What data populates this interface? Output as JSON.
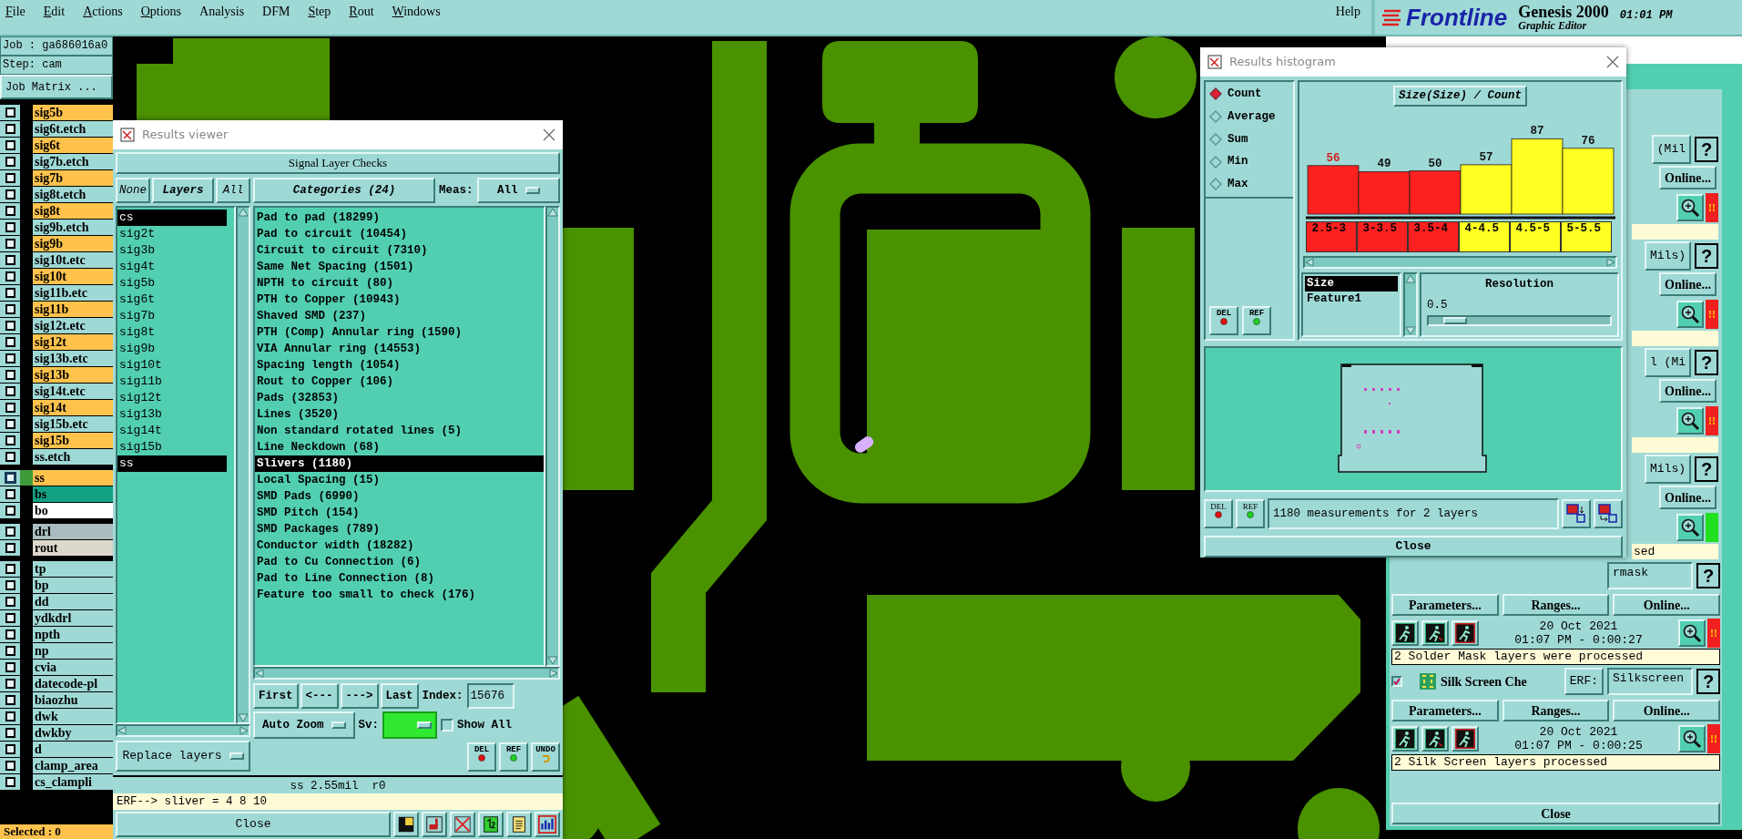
{
  "menu_bar": {
    "items": [
      {
        "label": "File",
        "underlined": true
      },
      {
        "label": "Edit",
        "underlined": true
      },
      {
        "label": "Actions",
        "underlined": true
      },
      {
        "label": "Options",
        "underlined": true
      },
      {
        "label": "Analysis",
        "underlined": false
      },
      {
        "label": "DFM",
        "underlined": false
      },
      {
        "label": "Step",
        "underlined": true
      },
      {
        "label": "Rout",
        "underlined": true
      },
      {
        "label": "Windows",
        "underlined": true
      }
    ],
    "help": "Help",
    "logo": "Frontline",
    "product": "Genesis 2000",
    "subtitle": "Graphic Editor",
    "time": "01:01 PM"
  },
  "job_panel": {
    "job": "Job : ga686016a0",
    "step": "Step: cam",
    "job_matrix_button": "Job Matrix ...",
    "layer_groups": [
      {
        "layers": [
          {
            "name": "sig5b",
            "color": "#ffc34d",
            "selected": false
          },
          {
            "name": "sig6t.etch",
            "color": "#9fd9d6",
            "selected": false
          },
          {
            "name": "sig6t",
            "color": "#ffc34d",
            "selected": false
          },
          {
            "name": "sig7b.etch",
            "color": "#9fd9d6",
            "selected": false
          },
          {
            "name": "sig7b",
            "color": "#ffc34d",
            "selected": false
          },
          {
            "name": "sig8t.etch",
            "color": "#9fd9d6",
            "selected": false
          },
          {
            "name": "sig8t",
            "color": "#ffc34d",
            "selected": false
          },
          {
            "name": "sig9b.etch",
            "color": "#9fd9d6",
            "selected": false
          },
          {
            "name": "sig9b",
            "color": "#ffc34d",
            "selected": false
          },
          {
            "name": "sig10t.etc",
            "color": "#9fd9d6",
            "selected": false
          },
          {
            "name": "sig10t",
            "color": "#ffc34d",
            "selected": false
          },
          {
            "name": "sig11b.etc",
            "color": "#9fd9d6",
            "selected": false
          },
          {
            "name": "sig11b",
            "color": "#ffc34d",
            "selected": false
          },
          {
            "name": "sig12t.etc",
            "color": "#9fd9d6",
            "selected": false
          },
          {
            "name": "sig12t",
            "color": "#ffc34d",
            "selected": false
          },
          {
            "name": "sig13b.etc",
            "color": "#9fd9d6",
            "selected": false
          },
          {
            "name": "sig13b",
            "color": "#ffc34d",
            "selected": false
          },
          {
            "name": "sig14t.etc",
            "color": "#9fd9d6",
            "selected": false
          },
          {
            "name": "sig14t",
            "color": "#ffc34d",
            "selected": false
          },
          {
            "name": "sig15b.etc",
            "color": "#9fd9d6",
            "selected": false
          },
          {
            "name": "sig15b",
            "color": "#ffc34d",
            "selected": false
          },
          {
            "name": "ss.etch",
            "color": "#9fd9d6",
            "selected": false
          }
        ]
      },
      {
        "layers": [
          {
            "name": "ss",
            "color": "#ffc34d",
            "selected": true
          },
          {
            "name": "bs",
            "color": "#12a184",
            "selected": false
          },
          {
            "name": "bo",
            "color": "#ffffff",
            "selected": false
          }
        ]
      },
      {
        "layers": [
          {
            "name": "drl",
            "color": "#a9bdc0",
            "selected": false
          },
          {
            "name": "rout",
            "color": "#ddd8cc",
            "selected": false
          }
        ]
      },
      {
        "layers": [
          {
            "name": "tp",
            "color": "#9fd9d6",
            "selected": false
          },
          {
            "name": "bp",
            "color": "#9fd9d6",
            "selected": false
          },
          {
            "name": "dd",
            "color": "#9fd9d6",
            "selected": false
          },
          {
            "name": "ydkdrl",
            "color": "#9fd9d6",
            "selected": false
          },
          {
            "name": "npth",
            "color": "#9fd9d6",
            "selected": false
          },
          {
            "name": "np",
            "color": "#9fd9d6",
            "selected": false
          },
          {
            "name": "cvia",
            "color": "#9fd9d6",
            "selected": false
          },
          {
            "name": "datecode-pl",
            "color": "#9fd9d6",
            "selected": false
          },
          {
            "name": "biaozhu",
            "color": "#9fd9d6",
            "selected": false
          },
          {
            "name": "dwk",
            "color": "#9fd9d6",
            "selected": false
          },
          {
            "name": "dwkby",
            "color": "#9fd9d6",
            "selected": false
          },
          {
            "name": "d",
            "color": "#9fd9d6",
            "selected": false
          },
          {
            "name": "clamp_area",
            "color": "#9fd9d6",
            "selected": false
          },
          {
            "name": "cs_clampli",
            "color": "#9fd9d6",
            "selected": false
          }
        ]
      }
    ],
    "selected_count": "Selected : 0"
  },
  "results_viewer": {
    "title": "Results viewer",
    "header": "Signal Layer Checks",
    "layer_buttons": [
      "None",
      "Layers",
      "All"
    ],
    "categories_button": "Categories (24)",
    "meas_label": "Meas:",
    "meas_value": "All",
    "layers": [
      {
        "name": "cs",
        "selected": true
      },
      {
        "name": "sig2t",
        "selected": false
      },
      {
        "name": "sig3b",
        "selected": false
      },
      {
        "name": "sig4t",
        "selected": false
      },
      {
        "name": "sig5b",
        "selected": false
      },
      {
        "name": "sig6t",
        "selected": false
      },
      {
        "name": "sig7b",
        "selected": false
      },
      {
        "name": "sig8t",
        "selected": false
      },
      {
        "name": "sig9b",
        "selected": false
      },
      {
        "name": "sig10t",
        "selected": false
      },
      {
        "name": "sig11b",
        "selected": false
      },
      {
        "name": "sig12t",
        "selected": false
      },
      {
        "name": "sig13b",
        "selected": false
      },
      {
        "name": "sig14t",
        "selected": false
      },
      {
        "name": "sig15b",
        "selected": false
      },
      {
        "name": "ss",
        "selected": true
      }
    ],
    "categories": [
      {
        "name": "Pad to pad (18299)",
        "selected": false
      },
      {
        "name": "Pad to circuit (10454)",
        "selected": false
      },
      {
        "name": "Circuit to circuit (7310)",
        "selected": false
      },
      {
        "name": "Same Net Spacing (1501)",
        "selected": false
      },
      {
        "name": "NPTH to circuit (80)",
        "selected": false
      },
      {
        "name": "PTH to Copper (10943)",
        "selected": false
      },
      {
        "name": "Shaved SMD (237)",
        "selected": false
      },
      {
        "name": "PTH (Comp) Annular ring (1590)",
        "selected": false
      },
      {
        "name": "VIA Annular ring (14553)",
        "selected": false
      },
      {
        "name": "Spacing length (1054)",
        "selected": false
      },
      {
        "name": "Rout to Copper (106)",
        "selected": false
      },
      {
        "name": "Pads (32853)",
        "selected": false
      },
      {
        "name": "Lines (3520)",
        "selected": false
      },
      {
        "name": "Non standard rotated lines (5)",
        "selected": false
      },
      {
        "name": "Line Neckdown (68)",
        "selected": false
      },
      {
        "name": "Slivers (1180)",
        "selected": true
      },
      {
        "name": "Local Spacing (15)",
        "selected": false
      },
      {
        "name": "SMD Pads (6990)",
        "selected": false
      },
      {
        "name": "SMD Pitch (154)",
        "selected": false
      },
      {
        "name": "SMD Packages (789)",
        "selected": false
      },
      {
        "name": "Conductor width (18282)",
        "selected": false
      },
      {
        "name": "Pad to Cu Connection (6)",
        "selected": false
      },
      {
        "name": "Pad to Line Connection (8)",
        "selected": false
      },
      {
        "name": "Feature too small to check (176)",
        "selected": false
      }
    ],
    "nav_buttons": [
      "First",
      "<---",
      "--->",
      "Last"
    ],
    "index_label": "Index:",
    "index_value": "15676",
    "zoom_mode": "Auto Zoom",
    "sv_label": "Sv:",
    "show_all": {
      "label": "Show All",
      "checked": false
    },
    "action_buttons": [
      {
        "label": "DEL",
        "kind": "del"
      },
      {
        "label": "REF",
        "kind": "ref"
      },
      {
        "label": "UNDO",
        "kind": "undo"
      }
    ],
    "replace_mode": "Replace layers",
    "status": "ss 2.55mil  r0",
    "erf_line": "ERF--> sliver = 4 8 10",
    "close": "Close"
  },
  "histogram": {
    "title": "Results histogram",
    "modes": [
      {
        "label": "Count",
        "selected": true
      },
      {
        "label": "Average",
        "selected": false
      },
      {
        "label": "Sum",
        "selected": false
      },
      {
        "label": "Min",
        "selected": false
      },
      {
        "label": "Max",
        "selected": false
      }
    ],
    "chart_title": "Size(Size) / Count",
    "chart_data": {
      "type": "bar",
      "categories": [
        "2.5-3",
        "3-3.5",
        "3.5-4",
        "4-4.5",
        "4.5-5",
        "5-5.5"
      ],
      "data_labels": true,
      "series": [
        {
          "color": "#ff2020",
          "values": [
            56,
            49,
            50,
            null,
            null,
            null
          ]
        },
        {
          "color": "#ffff22",
          "values": [
            null,
            null,
            null,
            57,
            87,
            76
          ]
        }
      ]
    },
    "fields": [
      {
        "label": "Size",
        "selected": true
      },
      {
        "label": "Feature1",
        "selected": false
      }
    ],
    "resolution": {
      "label": "Resolution",
      "value": "0.5",
      "level": 0.08
    },
    "side_buttons": [
      {
        "label": "DEL",
        "kind": "del"
      },
      {
        "label": "REF",
        "kind": "ref"
      }
    ],
    "bottom_buttons": [
      {
        "label": "DEL",
        "kind": "del"
      },
      {
        "label": "REF",
        "kind": "ref"
      }
    ],
    "summary": "1180 measurements for 2 layers",
    "close": "Close"
  },
  "checklist": {
    "partial_checks": [
      {
        "name": "(Mil",
        "help": "?",
        "button": "Online...",
        "color": "#f02020",
        "flag": "!!"
      },
      {
        "name": "Mils)",
        "help": "?",
        "button": "Online...",
        "color": "#f02020",
        "flag": "!!"
      },
      {
        "name": "l (Mi",
        "help": "?",
        "button": "Online...",
        "color": "#f02020",
        "flag": "!!"
      },
      {
        "name": "Mils)",
        "help": "?",
        "button": "Online...",
        "color": "#20e020",
        "message": "sed"
      }
    ],
    "checks": [
      {
        "erf_value": "rmask",
        "help": "?",
        "buttons": [
          "Parameters...",
          "Ranges...",
          "Online..."
        ],
        "date": "20 Oct 2021",
        "time": "01:07 PM - 0:00:27",
        "color": "#f02020",
        "flag": "!!",
        "message": "2 Solder Mask layers were processed"
      },
      {
        "checked": true,
        "name": "Silk Screen Che",
        "erf_label": "ERF:",
        "erf_value": "Silkscreen",
        "help": "?",
        "buttons": [
          "Parameters...",
          "Ranges...",
          "Online..."
        ],
        "date": "20 Oct 2021",
        "time": "01:07 PM - 0:00:25",
        "color": "#f02020",
        "flag": "!!",
        "message": "2 Silk Screen layers processed"
      }
    ],
    "close": "Close"
  }
}
